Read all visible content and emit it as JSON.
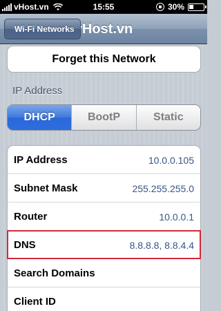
{
  "status_bar": {
    "carrier": "vHost.vn",
    "time": "15:55",
    "battery": "30%",
    "battery_level": 0.3
  },
  "nav": {
    "back_label": "Wi-Fi Networks",
    "title": "vHost.vn"
  },
  "forget_button": "Forget this Network",
  "section_label": "IP Address",
  "segments": [
    {
      "label": "DHCP",
      "selected": true
    },
    {
      "label": "BootP",
      "selected": false
    },
    {
      "label": "Static",
      "selected": false
    }
  ],
  "rows": [
    {
      "label": "IP Address",
      "value": "10.0.0.105"
    },
    {
      "label": "Subnet Mask",
      "value": "255.255.255.0"
    },
    {
      "label": "Router",
      "value": "10.0.0.1"
    },
    {
      "label": "DNS",
      "value": "8.8.8.8, 8.8.4.4"
    },
    {
      "label": "Search Domains",
      "value": ""
    },
    {
      "label": "Client ID",
      "value": ""
    }
  ],
  "colors": {
    "accent_blue": "#2f6cde",
    "value_text": "#385487",
    "highlight_red": "#d3283a"
  }
}
